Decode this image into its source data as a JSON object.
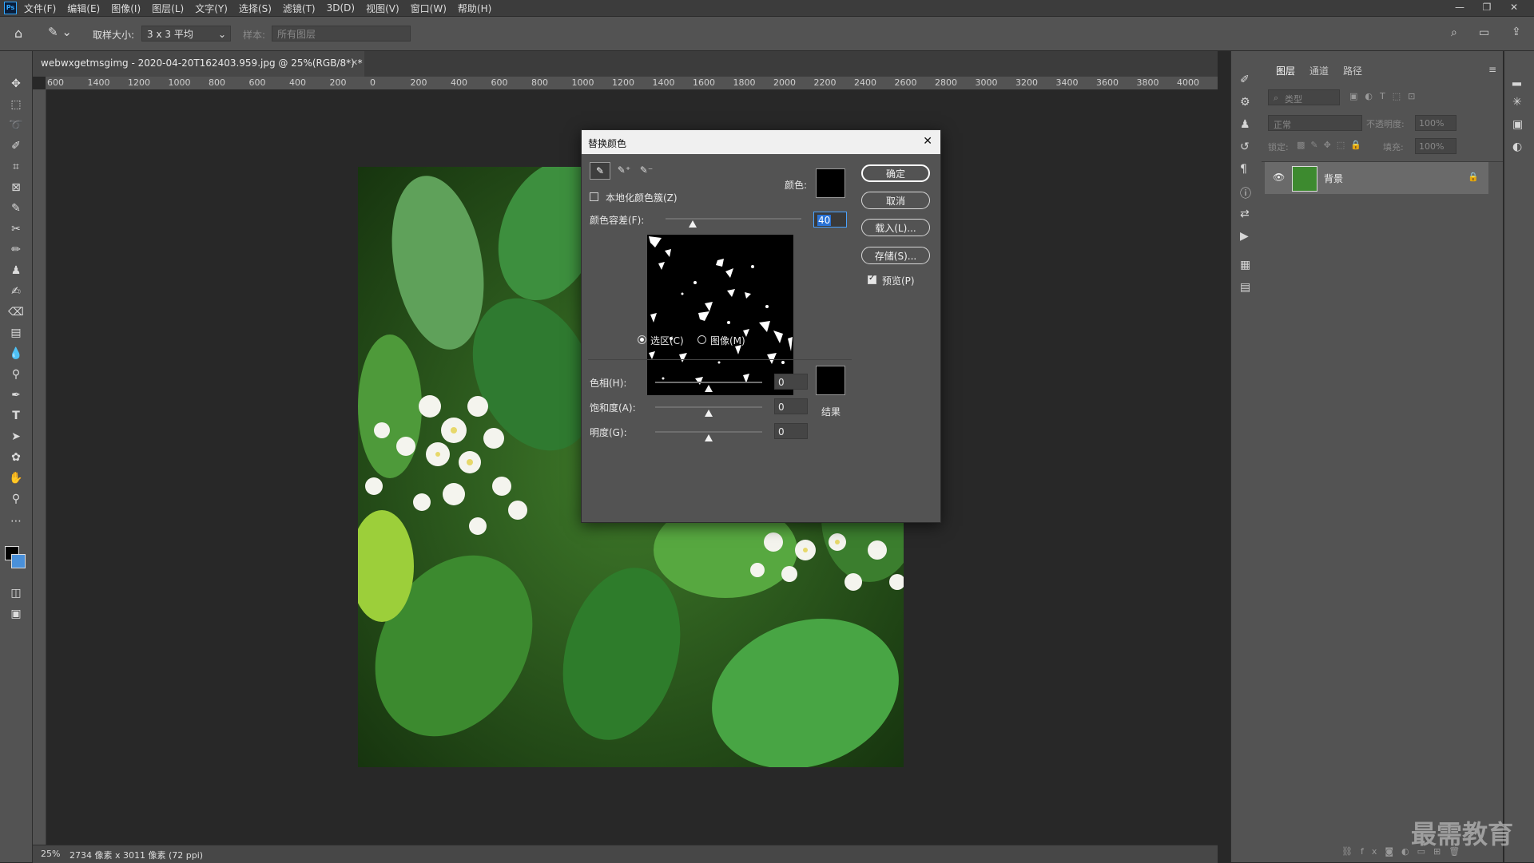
{
  "app": {
    "logo": "Ps"
  },
  "menubar": {
    "items": [
      "文件(F)",
      "编辑(E)",
      "图像(I)",
      "图层(L)",
      "文字(Y)",
      "选择(S)",
      "滤镜(T)",
      "3D(D)",
      "视图(V)",
      "窗口(W)",
      "帮助(H)"
    ]
  },
  "options": {
    "sample_size_label": "取样大小:",
    "sample_size_value": "3 x 3 平均",
    "sample_label": "样本:",
    "sample_value": "所有图层"
  },
  "document": {
    "tab_title": "webwxgetmsgimg - 2020-04-20T162403.959.jpg @ 25%(RGB/8*) *",
    "zoom": "25%",
    "size_info": "2734 像素 x 3011 像素 (72 ppi)"
  },
  "ruler": {
    "top_labels": [
      "600",
      "1400",
      "1200",
      "1000",
      "800",
      "600",
      "400",
      "200",
      "0",
      "200",
      "400",
      "600",
      "800",
      "1000",
      "1200",
      "1400",
      "1600",
      "1800",
      "2000",
      "2200",
      "2400",
      "2600",
      "2800",
      "3000",
      "3200",
      "3400",
      "3600",
      "3800",
      "4000",
      "420"
    ]
  },
  "dialog": {
    "title": "替换颜色",
    "localized_label": "本地化颜色簇(Z)",
    "color_label": "颜色:",
    "tolerance_label": "颜色容差(F):",
    "tolerance_value": "40",
    "tolerance_fraction": 0.2,
    "ok": "确定",
    "cancel": "取消",
    "load": "载入(L)...",
    "save": "存储(S)...",
    "preview": "预览(P)",
    "preview_checked": true,
    "selection_radio": "选区(C)",
    "image_radio": "图像(M)",
    "hue_label": "色相(H):",
    "hue_value": "0",
    "saturation_label": "饱和度(A):",
    "saturation_value": "0",
    "lightness_label": "明度(G):",
    "lightness_value": "0",
    "result_label": "结果",
    "swatch_color": "#000000"
  },
  "layers_panel": {
    "tabs": [
      "图层",
      "通道",
      "路径"
    ],
    "filter_placeholder": "类型",
    "blend_mode": "正常",
    "opacity_label": "不透明度:",
    "opacity_value": "100%",
    "lock_label": "锁定:",
    "fill_label": "填充:",
    "fill_value": "100%",
    "layer_name": "背景"
  },
  "watermark": "最需教育",
  "colors": {
    "accent": "#31a8ff",
    "panel": "#535353",
    "canvas": "#282828"
  }
}
